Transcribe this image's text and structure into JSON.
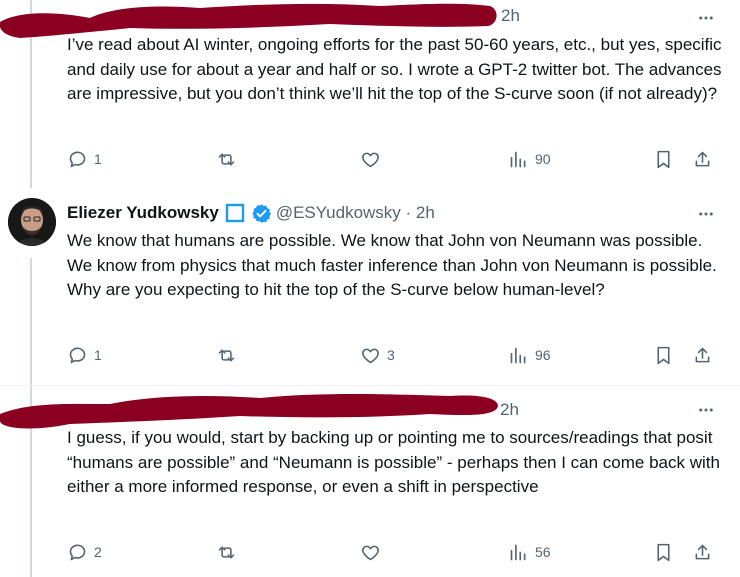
{
  "tweets": [
    {
      "time": "2h",
      "text": "I’ve read about AI winter, ongoing efforts for the past 50-60 years, etc., but yes, specific and daily use for about a year and half or so. I wrote a GPT-2 twitter bot. The advances are impressive, but you don’t think we’ll hit the top of the S-curve soon (if not already)?",
      "replies": "1",
      "reposts": "",
      "likes": "",
      "views": "90"
    },
    {
      "name": "Eliezer Yudkowsky",
      "handle": "@ESYudkowsky · 2h",
      "text": "We know that humans are possible.  We know that John von Neumann was possible.  We know from physics that much faster inference than John von Neumann is possible.  Why are you expecting to hit the top of the S-curve below human-level?",
      "replies": "1",
      "reposts": "",
      "likes": "3",
      "views": "96"
    },
    {
      "time": "2h",
      "text": "I guess, if you would, start by backing up or pointing me to sources/readings that posit “humans are possible” and “Neumann is possible” - perhaps then I can come back with either a more informed response, or even a shift in perspective",
      "replies": "2",
      "reposts": "",
      "likes": "",
      "views": "56"
    }
  ],
  "colors": {
    "redaction": "#8b0020",
    "verified": "#1d9bf0",
    "muted": "#536471"
  },
  "icons": [
    "more-icon",
    "reply-icon",
    "repost-icon",
    "like-icon",
    "views-icon",
    "bookmark-icon",
    "share-icon",
    "verified-icon",
    "square-badge-icon"
  ]
}
